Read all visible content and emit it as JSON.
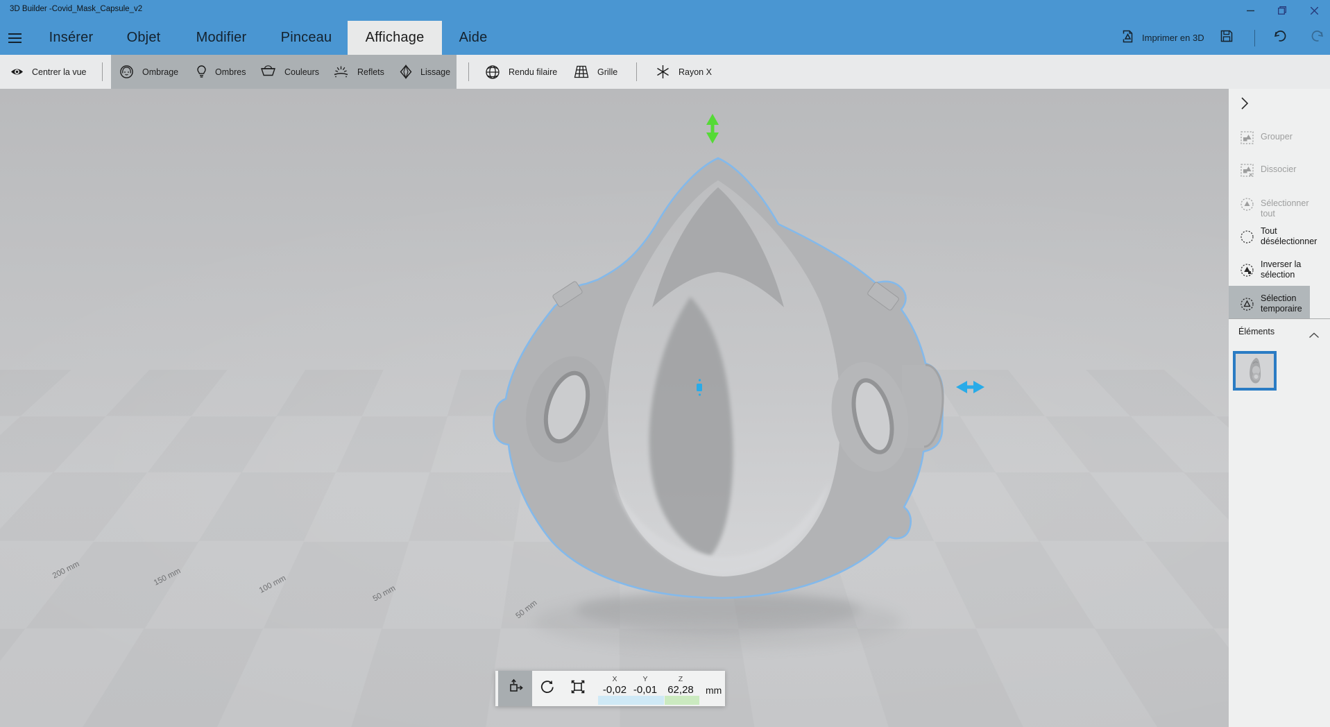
{
  "window": {
    "title": "3D Builder -Covid_Mask_Capsule_v2"
  },
  "menu": {
    "items": [
      "Insérer",
      "Objet",
      "Modifier",
      "Pinceau",
      "Affichage",
      "Aide"
    ],
    "active_item": "Affichage"
  },
  "quick_actions": {
    "print_label": "Imprimer en 3D"
  },
  "view_toolbar": {
    "center_view": "Centrer la vue",
    "shading": "Ombrage",
    "shadows": "Ombres",
    "colors": "Couleurs",
    "reflections": "Reflets",
    "smoothing": "Lissage",
    "wireframe": "Rendu filaire",
    "grid": "Grille",
    "xray": "Rayon X"
  },
  "panel": {
    "items": [
      {
        "label": "Grouper",
        "enabled": false
      },
      {
        "label": "Dissocier",
        "enabled": false
      },
      {
        "label": "Sélectionner tout",
        "enabled": false
      },
      {
        "label": "Tout désélectionner",
        "enabled": true
      },
      {
        "label": "Inverser la sélection",
        "enabled": true
      },
      {
        "label": "Sélection temporaire",
        "enabled": true,
        "selected": true
      }
    ],
    "elements_header": "Éléments",
    "elements_count": 1
  },
  "viewport": {
    "floor_labels": [
      {
        "text": "200 mm"
      },
      {
        "text": "150 mm"
      },
      {
        "text": "100 mm"
      },
      {
        "text": "50 mm"
      },
      {
        "text": "50 mm"
      }
    ],
    "selected_object": "Covid_Mask_Capsule_v2"
  },
  "transform_bar": {
    "selected_tool": "move",
    "axes": [
      {
        "label": "X",
        "value": "-0,02"
      },
      {
        "label": "Y",
        "value": "-0,01"
      },
      {
        "label": "Z",
        "value": "62,28"
      }
    ],
    "unit": "mm"
  },
  "colors": {
    "chrome_blue": "#4a96d2",
    "selection_outline": "#84b9ea",
    "gizmo_vertical_green": "#55da36",
    "gizmo_horizontal_blue": "#29abe8",
    "thumbnail_border": "#2b7cc4",
    "xy_strip_blue": "#cfe9f6",
    "z_strip_green": "#cbeac0",
    "panel_highlight": "#b1b7ba"
  }
}
